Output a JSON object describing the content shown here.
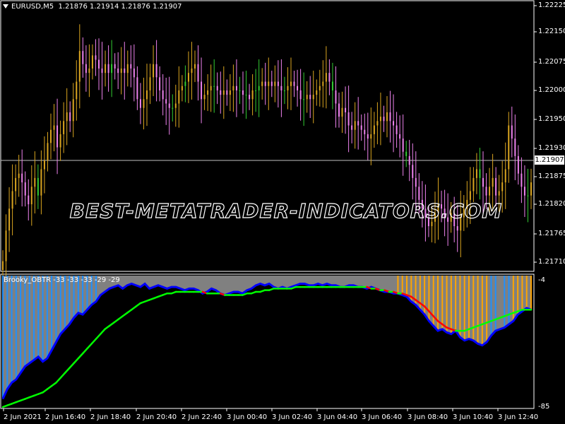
{
  "chart_header": {
    "symbol": "EURUSD,M5",
    "prices": "1.21876 1.21914 1.21876 1.21907"
  },
  "indicator": {
    "title": "Brooky_OBTR -33 -33 -33 -29 -29",
    "max_label": "-4",
    "min_label": "-85"
  },
  "current_price": "1.21907",
  "watermark": "BEST-METATRADER-INDICATORS.COM",
  "price_axis": {
    "labels": [
      "1.22225",
      "1.22150",
      "1.22075",
      "1.22000",
      "1.21950",
      "1.21930",
      "1.21875",
      "1.21820",
      "1.21765",
      "1.21710"
    ]
  },
  "time_axis": {
    "labels": [
      "2 Jun 2021",
      "2 Jun 16:40",
      "2 Jun 18:40",
      "2 Jun 20:40",
      "2 Jun 22:40",
      "3 Jun 00:40",
      "3 Jun 02:40",
      "3 Jun 04:40",
      "3 Jun 06:40",
      "3 Jun 08:40",
      "3 Jun 10:40",
      "3 Jun 12:40"
    ]
  },
  "colors": {
    "bull_candle": "#DAA520",
    "bear_candle": "#EE82EE",
    "neutral_candle": "#32CD32",
    "hist_blue": "#1E90FF",
    "hist_orange": "#FFA500",
    "hist_gray": "#808080",
    "line_blue": "#0000FF",
    "signal_up": "#00FF00",
    "signal_down": "#FF0000",
    "current_line": "#C0C0C0"
  },
  "chart_data": [
    {
      "type": "candlestick",
      "title": "EURUSD,M5",
      "ylim": [
        1.2169,
        1.223
      ],
      "close": [
        1.2171,
        1.2178,
        1.2183,
        1.2187,
        1.219,
        1.2191,
        1.2189,
        1.2186,
        1.2184,
        1.2188,
        1.219,
        1.2186,
        1.2192,
        1.2194,
        1.2198,
        1.2201,
        1.2202,
        1.2197,
        1.22,
        1.2203,
        1.2205,
        1.2203,
        1.2208,
        1.2212,
        1.2219,
        1.2216,
        1.2214,
        1.2215,
        1.2218,
        1.2217,
        1.2215,
        1.2214,
        1.2216,
        1.2214,
        1.2216,
        1.2215,
        1.2214,
        1.2215,
        1.2214,
        1.2216,
        1.2215,
        1.2213,
        1.2208,
        1.2206,
        1.2208,
        1.221,
        1.2213,
        1.2216,
        1.2213,
        1.221,
        1.2208,
        1.2207,
        1.2206,
        1.2206,
        1.2207,
        1.221,
        1.2211,
        1.2212,
        1.2214,
        1.2215,
        1.2216,
        1.2212,
        1.2208,
        1.2209,
        1.221,
        1.2211,
        1.2211,
        1.221,
        1.2209,
        1.221,
        1.2209,
        1.221,
        1.2211,
        1.221,
        1.221,
        1.2209,
        1.2209,
        1.2208,
        1.221,
        1.221,
        1.2211,
        1.2212,
        1.2211,
        1.2212,
        1.2211,
        1.2212,
        1.2211,
        1.221,
        1.221,
        1.2211,
        1.2212,
        1.2211,
        1.221,
        1.2208,
        1.2208,
        1.2209,
        1.2208,
        1.2209,
        1.221,
        1.2211,
        1.2212,
        1.2214,
        1.2212,
        1.221,
        1.2207,
        1.2204,
        1.2206,
        1.2205,
        1.2202,
        1.2201,
        1.2203,
        1.2202,
        1.2201,
        1.22,
        1.2199,
        1.22,
        1.2202,
        1.2203,
        1.2204,
        1.2203,
        1.2205,
        1.2203,
        1.2202,
        1.22,
        1.2199,
        1.2196,
        1.2195,
        1.2193,
        1.219,
        1.2188,
        1.2185,
        1.2183,
        1.2181,
        1.2179,
        1.218,
        1.2182,
        1.2184,
        1.2183,
        1.2181,
        1.218,
        1.2182,
        1.2179,
        1.2178,
        1.2181,
        1.2183,
        1.2185,
        1.2187,
        1.219,
        1.2192,
        1.219,
        1.2188,
        1.2186,
        1.2188,
        1.219,
        1.2186,
        1.2187,
        1.2189,
        1.2192,
        1.2202,
        1.2199,
        1.2195,
        1.2191,
        1.2188,
        1.2186,
        1.2186,
        1.2189
      ]
    },
    {
      "type": "line",
      "title": "Brooky_OBTR -33 -33 -33 -29 -29",
      "ylim": [
        -85,
        -4
      ],
      "series": [
        {
          "values": [
            -80,
            -74,
            -70,
            -68,
            -64,
            -60,
            -58,
            -56,
            -54,
            -57,
            -55,
            -50,
            -45,
            -40,
            -37,
            -34,
            -30,
            -27,
            -28,
            -25,
            -22,
            -20,
            -16,
            -14,
            -12,
            -11,
            -10,
            -12,
            -10,
            -9,
            -10,
            -11,
            -9,
            -12,
            -11,
            -10,
            -11,
            -12,
            -11,
            -11,
            -12,
            -13,
            -12,
            -12,
            -13,
            -15,
            -14,
            -12,
            -13,
            -15,
            -16,
            -15,
            -14,
            -14,
            -15,
            -13,
            -12,
            -10,
            -9,
            -10,
            -9,
            -11,
            -12,
            -11,
            -12,
            -11,
            -10,
            -9,
            -9,
            -10,
            -10,
            -9,
            -10,
            -9,
            -10,
            -10,
            -11,
            -11,
            -10,
            -10,
            -11,
            -11,
            -12,
            -11,
            -12,
            -13,
            -14,
            -14,
            -15,
            -15,
            -16,
            -17,
            -20,
            -22,
            -25,
            -28,
            -32,
            -35,
            -38,
            -37,
            -39,
            -40,
            -38,
            -42,
            -44,
            -43,
            -44,
            -46,
            -47,
            -45,
            -41,
            -38,
            -37,
            -36,
            -34,
            -32,
            -28,
            -26,
            -24,
            -25
          ]
        },
        {
          "values": [
            -85,
            -84,
            -83,
            -82,
            -81,
            -80,
            -79,
            -78,
            -77,
            -76,
            -74,
            -72,
            -70,
            -67,
            -64,
            -61,
            -58,
            -55,
            -52,
            -49,
            -46,
            -43,
            -40,
            -37,
            -35,
            -33,
            -31,
            -29,
            -27,
            -25,
            -23,
            -21,
            -20,
            -19,
            -18,
            -17,
            -16,
            -15,
            -15,
            -14,
            -14,
            -14,
            -14,
            -14,
            -14,
            -14,
            -15,
            -15,
            -15,
            -15,
            -16,
            -16,
            -16,
            -16,
            -16,
            -15,
            -15,
            -14,
            -14,
            -13,
            -13,
            -12,
            -12,
            -12,
            -12,
            -12,
            -11,
            -11,
            -11,
            -11,
            -11,
            -11,
            -11,
            -11,
            -11,
            -11,
            -11,
            -11,
            -11,
            -11,
            -11,
            -11,
            -11,
            -12,
            -12,
            -13,
            -13,
            -14,
            -14,
            -15,
            -15,
            -16,
            -17,
            -19,
            -21,
            -23,
            -26,
            -29,
            -32,
            -34,
            -36,
            -37,
            -38,
            -38,
            -38,
            -37,
            -36,
            -35,
            -34,
            -33,
            -32,
            -31,
            -30,
            -29,
            -28,
            -27,
            -26,
            -25,
            -25,
            -25
          ]
        }
      ]
    }
  ]
}
